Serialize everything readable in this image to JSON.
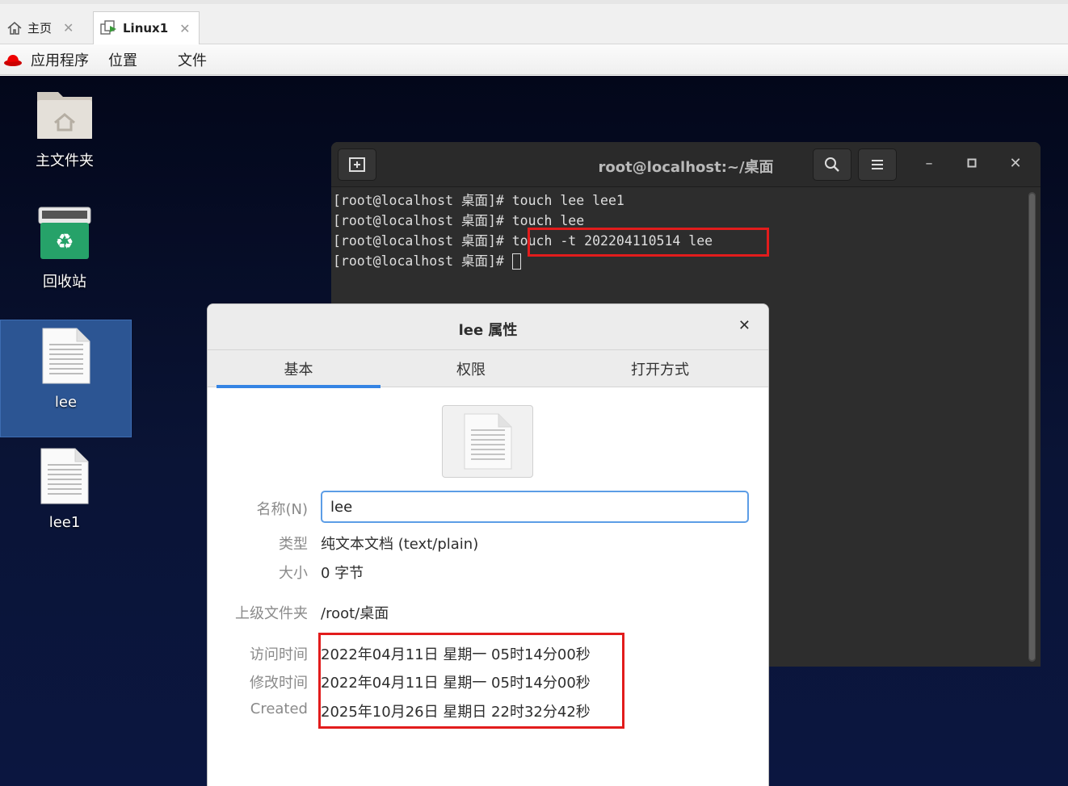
{
  "host_tabs": [
    {
      "label": "主页",
      "active": false
    },
    {
      "label": "Linux1",
      "active": true
    }
  ],
  "topbar": {
    "menus": [
      "应用程序",
      "位置",
      "文件"
    ]
  },
  "desktop": {
    "icons": [
      {
        "label": "主文件夹",
        "icon": "home-folder-icon"
      },
      {
        "label": "回收站",
        "icon": "trash-icon"
      },
      {
        "label": "lee",
        "icon": "text-file-icon",
        "selected": true
      },
      {
        "label": "lee1",
        "icon": "text-file-icon",
        "selected": false
      }
    ]
  },
  "terminal": {
    "title": "root@localhost:~/桌面",
    "lines": [
      "[root@localhost 桌面]# touch lee lee1",
      "[root@localhost 桌面]# touch lee",
      "[root@localhost 桌面]# touch -t 202204110514 lee",
      "[root@localhost 桌面]# "
    ]
  },
  "dialog": {
    "title": "lee 属性",
    "tabs": [
      {
        "label": "基本",
        "active": true
      },
      {
        "label": "权限",
        "active": false
      },
      {
        "label": "打开方式",
        "active": false
      }
    ],
    "name": {
      "label": "名称(N)",
      "value": "lee"
    },
    "type": {
      "label": "类型",
      "value": "纯文本文档 (text/plain)"
    },
    "size": {
      "label": "大小",
      "value": "0 字节"
    },
    "parent": {
      "label": "上级文件夹",
      "value": "/root/桌面"
    },
    "accessed": {
      "label": "访问时间",
      "value": "2022年04月11日 星期一 05时14分00秒"
    },
    "modified": {
      "label": "修改时间",
      "value": "2022年04月11日 星期一 05时14分00秒"
    },
    "created": {
      "label": "Created",
      "value": "2025年10月26日 星期日 22时32分42秒"
    }
  },
  "colors": {
    "highlight_red": "#e21c1c",
    "accent_blue": "#3584e4",
    "terminal_bg": "#2d2d2d"
  }
}
